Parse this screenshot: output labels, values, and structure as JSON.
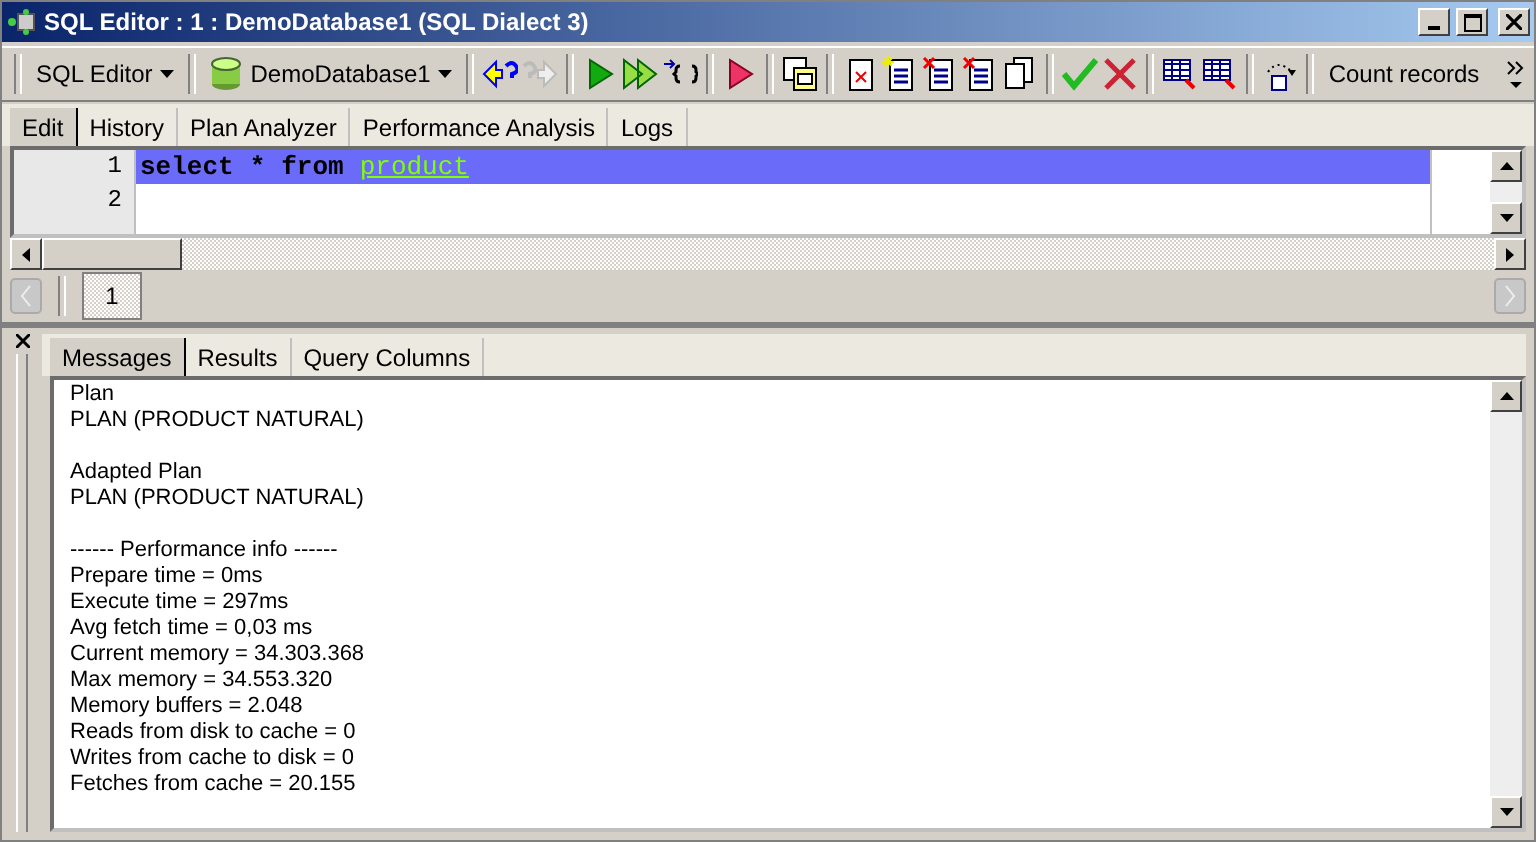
{
  "window": {
    "title": "SQL Editor : 1 : DemoDatabase1 (SQL Dialect 3)"
  },
  "toolbar": {
    "editor_menu": "SQL Editor",
    "database_menu": "DemoDatabase1",
    "count_button": "Count records"
  },
  "editor_tabs": [
    {
      "label": "Edit",
      "selected": true
    },
    {
      "label": "History",
      "selected": false
    },
    {
      "label": "Plan Analyzer",
      "selected": false
    },
    {
      "label": "Performance Analysis",
      "selected": false
    },
    {
      "label": "Logs",
      "selected": false
    }
  ],
  "editor": {
    "lines": [
      {
        "number": "1",
        "selected": true,
        "tokens": [
          {
            "text": "select",
            "kind": "keyword"
          },
          {
            "text": "*",
            "kind": "keyword"
          },
          {
            "text": "from",
            "kind": "keyword"
          },
          {
            "text": "product",
            "kind": "identifier"
          }
        ]
      },
      {
        "number": "2",
        "selected": false
      }
    ]
  },
  "pages": [
    {
      "label": "1",
      "selected": true
    }
  ],
  "result_tabs": [
    {
      "label": "Messages",
      "selected": true
    },
    {
      "label": "Results",
      "selected": false
    },
    {
      "label": "Query Columns",
      "selected": false
    }
  ],
  "messages": [
    [
      "Plan",
      "PLAN (PRODUCT NATURAL)"
    ],
    [
      "Adapted Plan",
      "PLAN (PRODUCT NATURAL)"
    ],
    [
      "------ Performance info ------",
      "Prepare time = 0ms",
      "Execute time = 297ms",
      "Avg fetch time = 0,03 ms",
      "Current memory = 34.303.368",
      "Max memory = 34.553.320",
      "Memory buffers = 2.048",
      "Reads from disk to cache = 0",
      "Writes from cache to disk = 0",
      "Fetches from cache = 20.155"
    ]
  ]
}
